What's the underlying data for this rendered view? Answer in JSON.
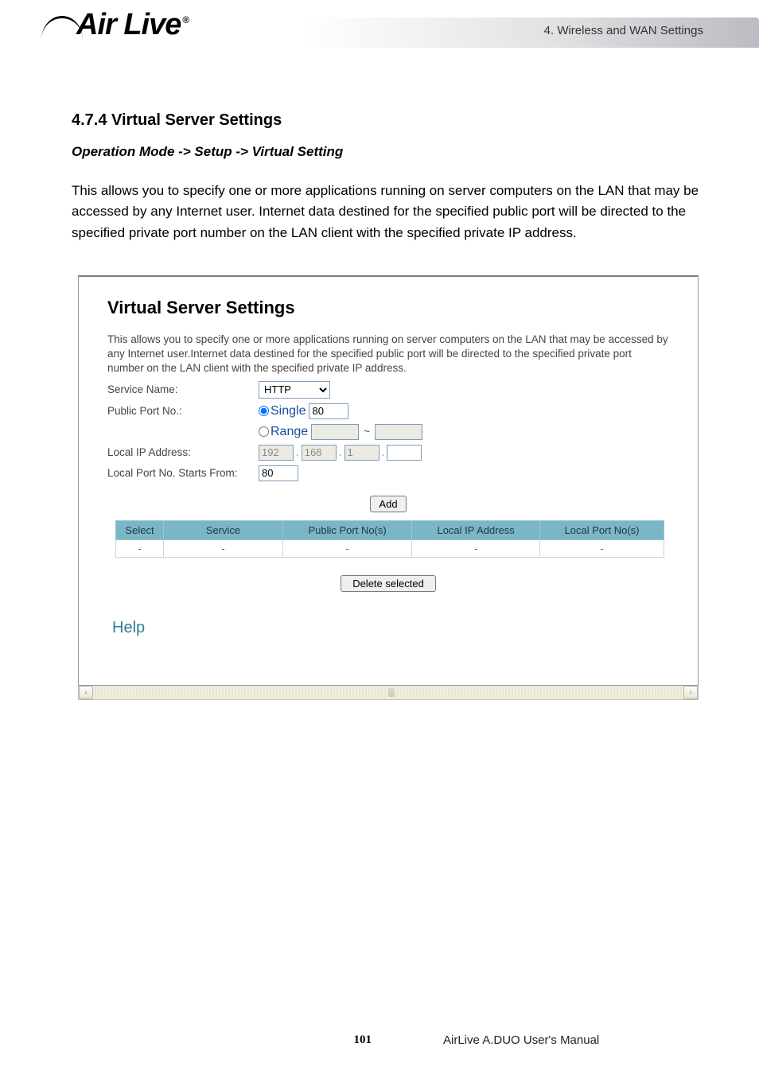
{
  "header": {
    "chapter": "4.  Wireless  and  WAN  Settings",
    "logo_text": "Air Live",
    "logo_reg": "®"
  },
  "doc": {
    "section_heading": "4.7.4 Virtual Server Settings",
    "breadcrumb": "Operation Mode -> Setup -> Virtual Setting",
    "body": "This allows you to specify one or more applications running on server computers on the LAN that may be accessed by any Internet user. Internet data destined for the specified public port will be directed to the specified private port number on the LAN client with the specified private IP address."
  },
  "panel": {
    "title": "Virtual Server Settings",
    "desc": "This allows you to specify one or more applications running on server computers on the LAN that may be accessed by any Internet user.Internet data destined for the specified public port will be directed to the specified private port number on the LAN client with the specified private IP address.",
    "labels": {
      "service_name": "Service Name:",
      "public_port": "Public Port No.:",
      "local_ip": "Local IP Address:",
      "local_port_start": "Local Port No. Starts From:"
    },
    "service_select": "HTTP",
    "port_mode_single": "Single",
    "port_mode_range": "Range",
    "single_value": "80",
    "range_from": "",
    "range_to": "",
    "range_sep": "~",
    "ip": {
      "o1": "192",
      "o2": "168",
      "o3": "1",
      "o4": ""
    },
    "local_port_value": "80",
    "add_btn": "Add",
    "delete_btn": "Delete selected",
    "help": "Help",
    "table": {
      "headers": [
        "Select",
        "Service",
        "Public Port No(s)",
        "Local IP Address",
        "Local Port No(s)"
      ],
      "row": [
        "-",
        "-",
        "-",
        "-",
        "-"
      ]
    }
  },
  "footer": {
    "page": "101",
    "manual": "AirLive A.DUO User's Manual"
  },
  "scroll": {
    "left": "‹",
    "right": "›"
  }
}
